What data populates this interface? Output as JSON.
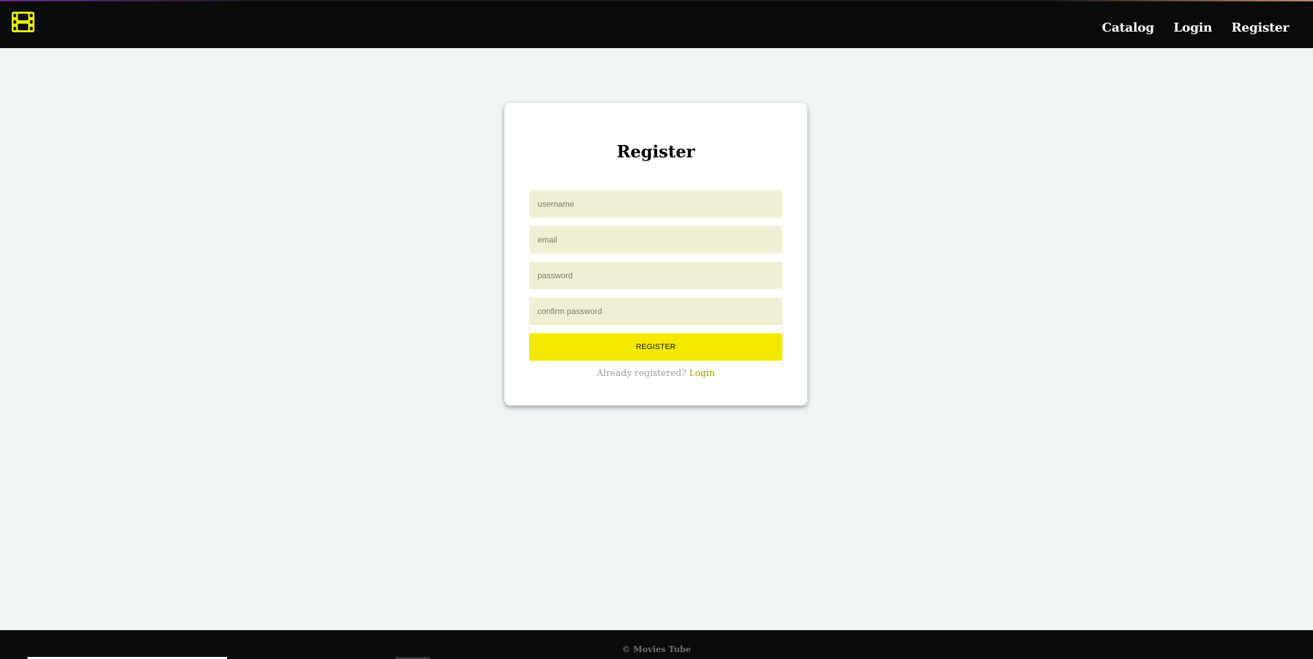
{
  "header": {
    "logo_icon": "film-icon",
    "accent_color": "#e6f000",
    "nav": {
      "catalog": "Catalog",
      "login": "Login",
      "register": "Register"
    }
  },
  "form": {
    "title": "Register",
    "username": {
      "placeholder": "username",
      "value": ""
    },
    "email": {
      "placeholder": "email",
      "value": ""
    },
    "password": {
      "placeholder": "password",
      "value": ""
    },
    "confirm_password": {
      "placeholder": "confirm password",
      "value": ""
    },
    "submit_label": "REGISTER",
    "submit_color": "#f2ea00",
    "already_text": "Already registered?",
    "login_link": "Login"
  },
  "footer": {
    "copyright": "© Movies Tube"
  }
}
